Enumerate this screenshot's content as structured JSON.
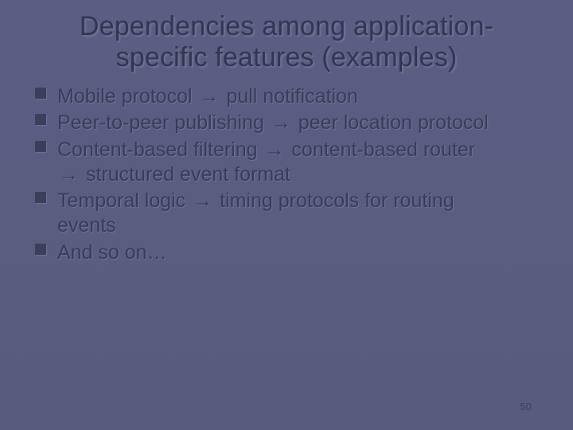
{
  "title_line1": "Dependencies among application-",
  "title_line2": "specific features (examples)",
  "arrow": "→",
  "bullets": [
    {
      "pre": "Mobile protocol ",
      "post": " pull notification",
      "cont": ""
    },
    {
      "pre": "Peer-to-peer publishing ",
      "post": " peer location protocol",
      "cont": ""
    },
    {
      "pre": "Content-based filtering ",
      "post": " content-based router",
      "cont_pre_arrow": true,
      "cont": " structured event format"
    },
    {
      "pre": "Temporal logic ",
      "post": " timing protocols for routing",
      "cont": "events"
    },
    {
      "pre": "And so on…",
      "no_arrow": true
    }
  ],
  "slide_number": "50"
}
